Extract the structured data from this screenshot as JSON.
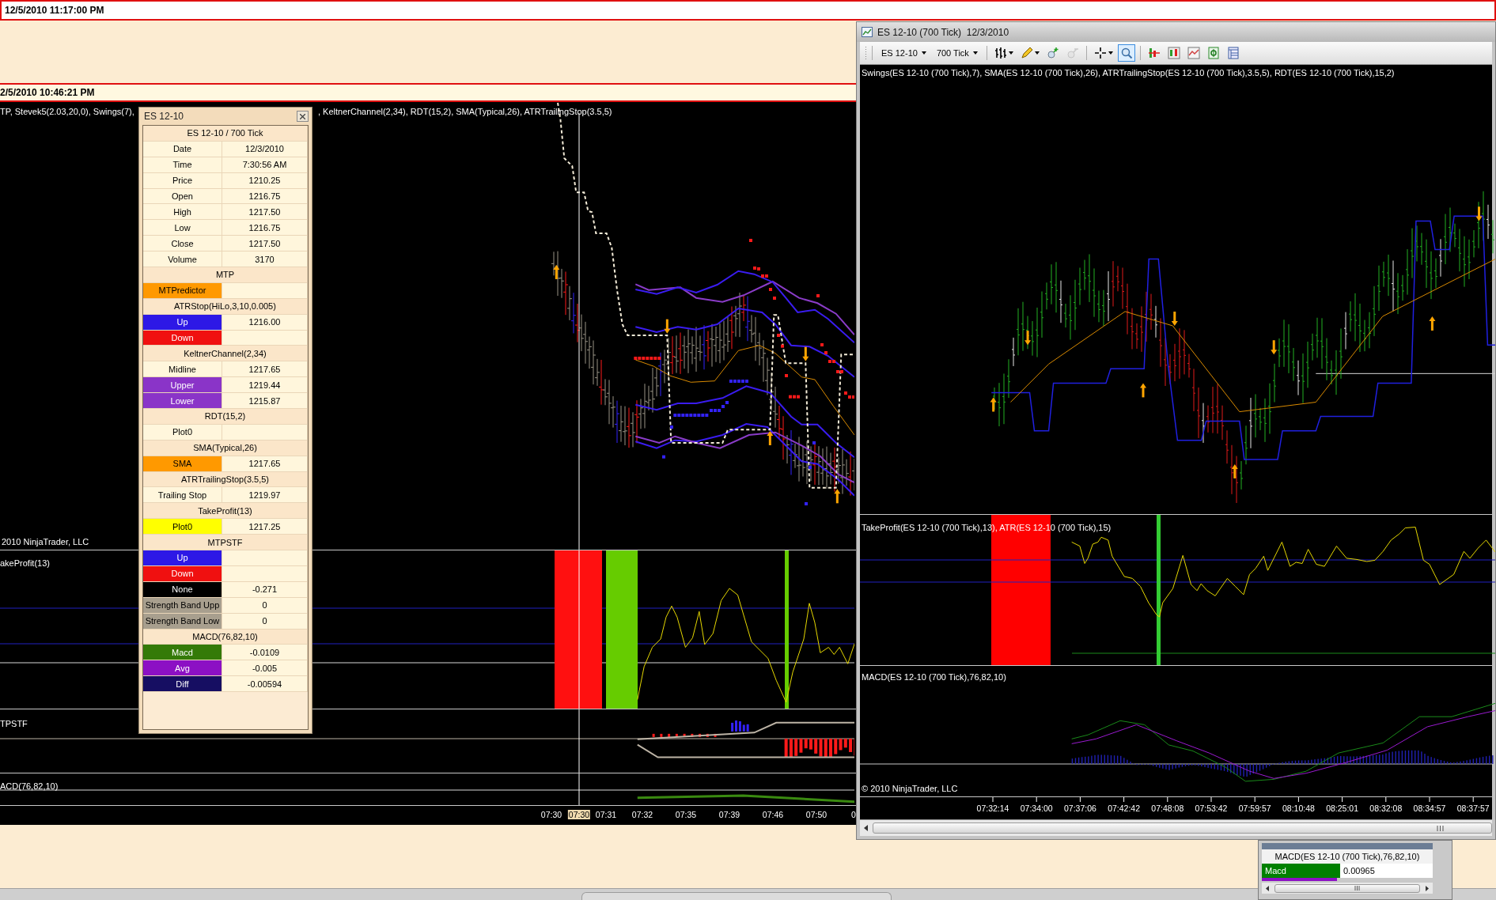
{
  "top_bar": {
    "timestamp": "12/5/2010 11:17:00 PM"
  },
  "left_window": {
    "timestamp": "2/5/2010 10:46:21 PM",
    "legend_left": "TP, Stevek5(2.03,20,0), Swings(7),",
    "legend_right": ", KeltnerChannel(2,34), RDT(15,2), SMA(Typical,26), ATRTrailingStop(3.5,5)",
    "copyright": "2010 NinjaTrader, LLC",
    "panel_labels": [
      "akeProfit(13)",
      "TPSTF",
      "ACD(76,82,10)"
    ],
    "time_axis": [
      {
        "label": "07:30",
        "kind": "tick"
      },
      {
        "label": "07:30",
        "kind": "cursor"
      },
      {
        "label": "07:31",
        "kind": "tick"
      },
      {
        "label": "07:32",
        "kind": "tick"
      },
      {
        "label": "07:35",
        "kind": "tick"
      },
      {
        "label": "07:39",
        "kind": "tick"
      },
      {
        "label": "07:46",
        "kind": "tick"
      },
      {
        "label": "07:50",
        "kind": "tick"
      },
      {
        "label": "0",
        "kind": "tick"
      }
    ]
  },
  "data_box": {
    "title": "ES 12-10",
    "header": "ES 12-10 / 700 Tick",
    "rows": [
      {
        "kind": "field",
        "label": "Date",
        "value": "12/3/2010"
      },
      {
        "kind": "field",
        "label": "Time",
        "value": "7:30:56 AM"
      },
      {
        "kind": "field",
        "label": "Price",
        "value": "1210.25"
      },
      {
        "kind": "field",
        "label": "Open",
        "value": "1216.75"
      },
      {
        "kind": "field",
        "label": "High",
        "value": "1217.50"
      },
      {
        "kind": "field",
        "label": "Low",
        "value": "1216.75"
      },
      {
        "kind": "field",
        "label": "Close",
        "value": "1217.50"
      },
      {
        "kind": "field",
        "label": "Volume",
        "value": "3170"
      },
      {
        "kind": "section",
        "label": "MTP"
      },
      {
        "kind": "plot",
        "label": "MTPredictor",
        "color": "#ff9900"
      },
      {
        "kind": "section",
        "label": "ATRStop(HiLo,3,10,0.005)"
      },
      {
        "kind": "plot",
        "label": "Up",
        "color": "#2d18e6",
        "value": "1216.00"
      },
      {
        "kind": "plot",
        "label": "Down",
        "color": "#f01010"
      },
      {
        "kind": "section",
        "label": "KeltnerChannel(2,34)"
      },
      {
        "kind": "field",
        "label": "Midline",
        "value": "1217.65"
      },
      {
        "kind": "plot",
        "label": "Upper",
        "color": "#8a34c8",
        "value": "1219.44"
      },
      {
        "kind": "plot",
        "label": "Lower",
        "color": "#8a34c8",
        "value": "1215.87"
      },
      {
        "kind": "section",
        "label": "RDT(15,2)"
      },
      {
        "kind": "field",
        "label": "Plot0"
      },
      {
        "kind": "section",
        "label": "SMA(Typical,26)"
      },
      {
        "kind": "plot",
        "label": "SMA",
        "color": "#ff9900",
        "value": "1217.65"
      },
      {
        "kind": "section",
        "label": "ATRTrailingStop(3.5,5)"
      },
      {
        "kind": "field",
        "label": "Trailing Stop",
        "value": "1219.97"
      },
      {
        "kind": "section",
        "label": "TakeProfit(13)"
      },
      {
        "kind": "plot",
        "label": "Plot0",
        "color": "#ffff00",
        "value": "1217.25"
      },
      {
        "kind": "section",
        "label": "MTPSTF"
      },
      {
        "kind": "plot",
        "label": "Up",
        "color": "#2d18e6"
      },
      {
        "kind": "plot",
        "label": "Down",
        "color": "#f01010"
      },
      {
        "kind": "plot",
        "label": "None",
        "color": "#000000",
        "value": "-0.271"
      },
      {
        "kind": "plot",
        "label": "Strength Band Upp",
        "color": "#a89f8e",
        "value": "0"
      },
      {
        "kind": "plot",
        "label": "Strength Band Low",
        "color": "#a89f8e",
        "value": "0"
      },
      {
        "kind": "section",
        "label": "MACD(76,82,10)"
      },
      {
        "kind": "plot",
        "label": "Macd",
        "color": "#347a08",
        "value": "-0.0109"
      },
      {
        "kind": "plot",
        "label": "Avg",
        "color": "#8c10c4",
        "value": "-0.005"
      },
      {
        "kind": "plot",
        "label": "Diff",
        "color": "#160e62",
        "value": "-0.00594"
      }
    ]
  },
  "right_window": {
    "title": "ES 12-10 (700 Tick)  12/3/2010",
    "instrument": "ES 12-10",
    "interval": "700 Tick",
    "tools": [
      {
        "kind": "bar_type",
        "menu": true,
        "selected": false,
        "disabled": false
      },
      {
        "kind": "drawing",
        "menu": true,
        "selected": false,
        "disabled": false
      },
      {
        "kind": "zoom_in",
        "menu": false,
        "selected": false,
        "disabled": false
      },
      {
        "kind": "zoom_out",
        "menu": false,
        "selected": false,
        "disabled": true
      },
      {
        "kind": "crosshair",
        "menu": true,
        "selected": false,
        "disabled": false
      },
      {
        "kind": "zoom_box",
        "menu": false,
        "selected": true,
        "disabled": false
      },
      {
        "kind": "indicators",
        "menu": false,
        "selected": false,
        "disabled": false
      },
      {
        "kind": "candles",
        "menu": false,
        "selected": false,
        "disabled": false
      },
      {
        "kind": "line_chart",
        "menu": false,
        "selected": false,
        "disabled": false
      },
      {
        "kind": "dollar",
        "menu": false,
        "selected": false,
        "disabled": false
      },
      {
        "kind": "properties",
        "menu": false,
        "selected": false,
        "disabled": false
      }
    ],
    "price_legend": "Swings(ES 12-10 (700 Tick),7), SMA(ES 12-10 (700 Tick),26), ATRTrailingStop(ES 12-10 (700 Tick),3.5,5), RDT(ES 12-10 (700 Tick),15,2)",
    "takeprofit_legend": "TakeProfit(ES 12-10 (700 Tick),13), ATR(ES 12-10 (700 Tick),15)",
    "macd_legend": "MACD(ES 12-10 (700 Tick),76,82,10)",
    "copyright": "© 2010 NinjaTrader, LLC",
    "time_axis": [
      "07:32:14",
      "07:34:00",
      "07:37:06",
      "07:42:42",
      "07:48:08",
      "07:53:42",
      "07:59:57",
      "08:10:48",
      "08:25:01",
      "08:32:08",
      "08:34:57",
      "08:37:57"
    ]
  },
  "data_panel": {
    "header": "MACD(ES 12-10 (700 Tick),76,82,10)",
    "rows": [
      {
        "label": "Macd",
        "color": "#008000",
        "value": "0.00965"
      }
    ]
  }
}
